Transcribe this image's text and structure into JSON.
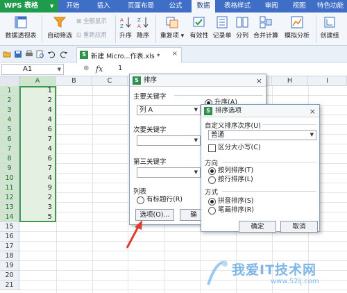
{
  "app": {
    "name": "WPS 表格"
  },
  "menu_tabs": [
    "开始",
    "插入",
    "页面布局",
    "公式",
    "数据",
    "表格样式",
    "审阅",
    "视图",
    "特色功能"
  ],
  "active_tab": "数据",
  "ribbon": {
    "pivot": "数据透视表",
    "autofilter": "自动筛选",
    "show_all": "全部显示",
    "reapply": "重新应用",
    "sort_asc": "升序",
    "sort_desc": "降序",
    "duplicates": "重复项",
    "validity": "有效性",
    "record_form": "记录单",
    "split": "分列",
    "consolidate": "合并计算",
    "simulate": "模拟分析",
    "create_group": "创建组"
  },
  "document_tab": {
    "title": "新建 Micro...作表.xls *"
  },
  "formula_bar": {
    "name_box": "A1",
    "fx": "fx",
    "value": "1"
  },
  "sheet": {
    "columns": [
      "A",
      "B",
      "C",
      "D",
      "E",
      "F",
      "G",
      "H",
      "I"
    ],
    "rows": [
      "1",
      "2",
      "3",
      "4",
      "5",
      "6",
      "7",
      "8",
      "9",
      "10",
      "11",
      "12",
      "13",
      "14",
      "15",
      "16",
      "17",
      "18",
      "19",
      "20",
      "21"
    ],
    "column_a_values": [
      "1",
      "2",
      "4",
      "4",
      "6",
      "7",
      "4",
      "6",
      "7",
      "4",
      "9",
      "2",
      "3",
      "5"
    ]
  },
  "sort_dialog": {
    "title": "排序",
    "primary_key_label": "主要关键字",
    "primary_key_value": "列 A",
    "order_asc": "升序(A)",
    "secondary_key_label": "次要关键字",
    "third_key_label": "第三关键字",
    "list_label": "列表",
    "has_header": "有标题行(R)",
    "options_button": "选项(O)...",
    "ok_button": "确"
  },
  "options_dialog": {
    "title": "排序选项",
    "custom_order_label": "自定义排序次序(U)",
    "custom_order_value": "普通",
    "case_sensitive": "区分大小写(C)",
    "direction_label": "方向",
    "by_column": "按列排序(T)",
    "by_row": "按行排序(L)",
    "method_label": "方式",
    "pinyin": "拼音排序(S)",
    "stroke": "笔画排序(R)",
    "ok_button": "确定",
    "cancel_button": "取消"
  },
  "watermark": {
    "text": "我爱IT技术网",
    "url": "www.52ij.com"
  },
  "colors": {
    "tabbar": "#3f6ec6",
    "app_button": "#1f9b4c",
    "selection": "#3d9a4e",
    "arrow": "#e23b2e"
  }
}
